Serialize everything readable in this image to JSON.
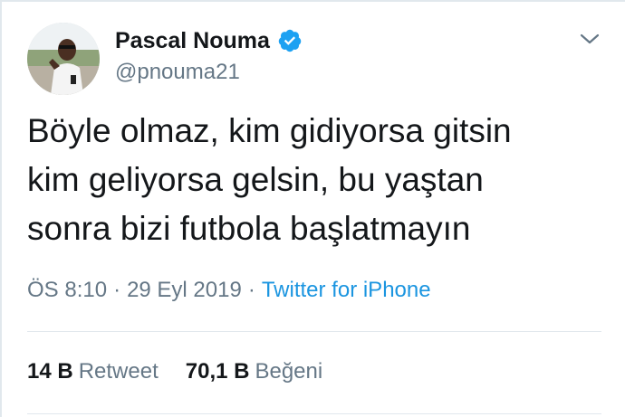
{
  "author": {
    "display_name": "Pascal Nouma",
    "handle": "@pnouma21",
    "verified_icon": "verified-badge-icon",
    "avatar_icon": "profile-photo"
  },
  "menu": {
    "icon": "chevron-down-icon"
  },
  "tweet": {
    "lines": [
      "Böyle olmaz, kim gidiyorsa gitsin",
      "kim geliyorsa gelsin, bu yaştan",
      "sonra bizi futbola başlatmayın"
    ]
  },
  "meta": {
    "time": "ÖS 8:10",
    "separator": "·",
    "date": "29 Eyl 2019",
    "source": "Twitter for iPhone"
  },
  "stats": {
    "retweets_count": "14 B",
    "retweets_label": "Retweet",
    "likes_count": "70,1 B",
    "likes_label": "Beğeni"
  },
  "colors": {
    "text": "#14171a",
    "secondary": "#657786",
    "link": "#1b95e0",
    "verified": "#1da1f2",
    "border": "#e1e8ed"
  }
}
